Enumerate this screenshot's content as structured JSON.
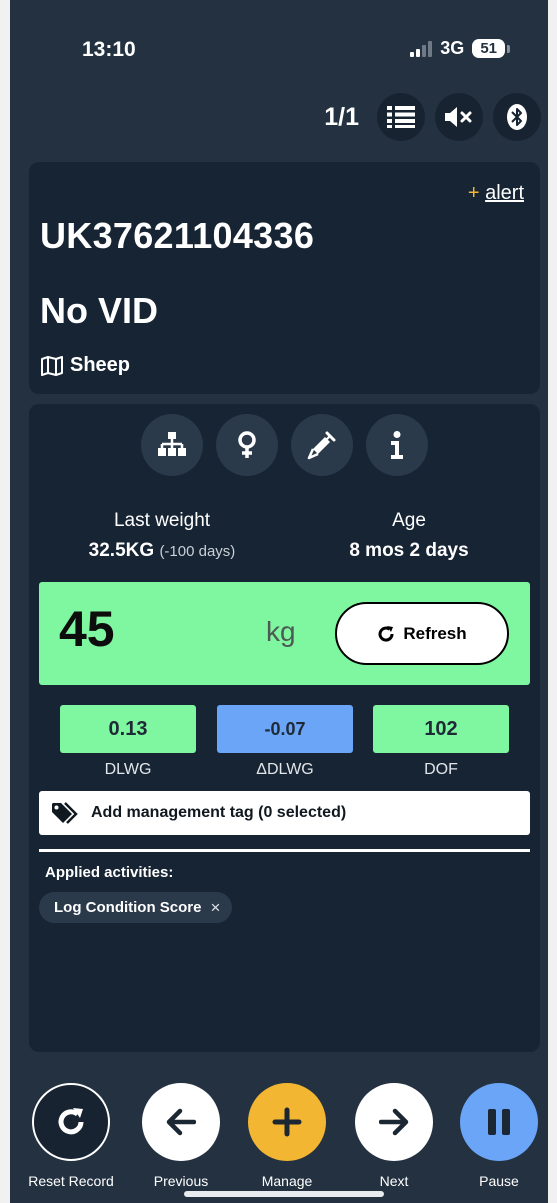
{
  "status": {
    "time": "13:10",
    "network": "3G",
    "battery": "51"
  },
  "toolbar": {
    "page_count": "1/1",
    "icons": [
      "list-icon",
      "mute-icon",
      "bluetooth-icon"
    ]
  },
  "animal": {
    "alert_plus": "+",
    "alert_label": "alert",
    "eid": "UK37621104336",
    "vid": "No VID",
    "species": "Sheep"
  },
  "action_icons": [
    "pedigree-icon",
    "female-icon",
    "syringe-icon",
    "info-icon"
  ],
  "last_weight": {
    "label": "Last weight",
    "value": "32.5KG",
    "detail": "(-100 days)"
  },
  "age": {
    "label": "Age",
    "value": "8 mos 2 days"
  },
  "weigh": {
    "value": "45",
    "unit": "kg",
    "refresh_label": "Refresh"
  },
  "metrics": [
    {
      "value": "0.13",
      "label": "DLWG",
      "color": "#7ff6a0"
    },
    {
      "value": "-0.07",
      "label": "ΔDLWG",
      "color": "#6aa5f7"
    },
    {
      "value": "102",
      "label": "DOF",
      "color": "#7ff6a0"
    }
  ],
  "management_tag": {
    "label": "Add management tag (0 selected)"
  },
  "activities": {
    "title": "Applied activities:",
    "items": [
      {
        "label": "Log Condition Score",
        "remove": "×"
      }
    ]
  },
  "nav": {
    "reset": "Reset Record",
    "previous": "Previous",
    "manage": "Manage",
    "next": "Next",
    "pause": "Pause"
  },
  "colors": {
    "background": "#233140",
    "card": "#172433",
    "green": "#7ff6a0",
    "blue": "#6aa5f7",
    "yellow": "#f2b632"
  }
}
